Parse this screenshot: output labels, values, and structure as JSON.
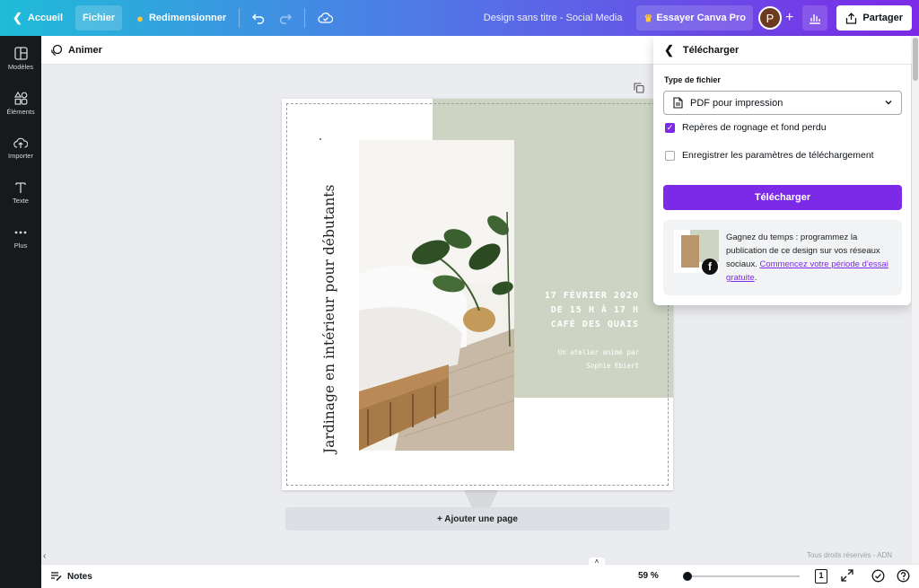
{
  "topbar": {
    "home_label": "Accueil",
    "file_label": "Fichier",
    "resize_label": "Redimensionner",
    "doc_title": "Design sans titre - Social Media",
    "pro_label": "Essayer Canva Pro",
    "avatar_initial": "P",
    "share_label": "Partager"
  },
  "sidebar": {
    "items": [
      {
        "label": "Modèles",
        "icon": "templates-icon"
      },
      {
        "label": "Éléments",
        "icon": "elements-icon"
      },
      {
        "label": "Importer",
        "icon": "upload-icon"
      },
      {
        "label": "Texte",
        "icon": "text-icon"
      },
      {
        "label": "Plus",
        "icon": "more-icon"
      }
    ]
  },
  "subbar": {
    "animate_label": "Animer"
  },
  "design": {
    "vertical_title": "Jardinage en intérieur pour débutants",
    "date_line": "17 FÉVRIER 2020",
    "time_line": "DE 15 H À 17 H",
    "place_line": "CAFÉ DES QUAIS",
    "credit_line1": "Un atelier animé par",
    "credit_line2": "Sophie Ebiert",
    "green": "#cdd4c3"
  },
  "canvas": {
    "add_page_label": "+ Ajouter une page",
    "copyright": "Tous droits réservés - ADN"
  },
  "bottombar": {
    "notes_label": "Notes",
    "zoom": "59 %",
    "page_number": "1"
  },
  "download_panel": {
    "title": "Télécharger",
    "file_type_label": "Type de fichier",
    "file_type_value": "PDF pour impression",
    "crop_marks_label": "Repères de rognage et fond perdu",
    "crop_marks_checked": true,
    "save_settings_label": "Enregistrer les paramètres de téléchargement",
    "save_settings_checked": false,
    "download_button": "Télécharger",
    "promo_text": "Gagnez du temps : programmez la publication de ce design sur vos réseaux sociaux.",
    "promo_link": "Commencez votre période d'essai gratuite",
    "promo_end": "."
  },
  "colors": {
    "accent": "#7d2ae8",
    "sidebar_bg": "#18191b",
    "gradient_start": "#1fbcd8",
    "gradient_end": "#7d2ae8"
  }
}
